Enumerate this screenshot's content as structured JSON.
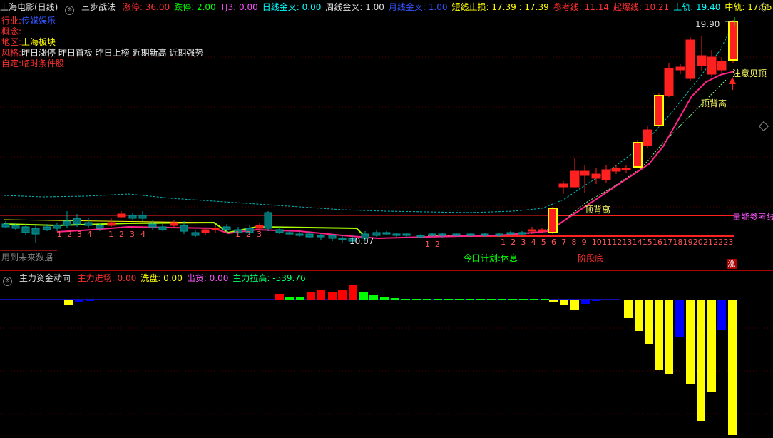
{
  "main_header": {
    "title": "上海电影(日线)",
    "indicator": "三步战法",
    "items": [
      {
        "label": "涨停: 36.00",
        "color": "#ff3030"
      },
      {
        "label": "跌停: 2.00",
        "color": "#00ff00"
      },
      {
        "label": "TJ3: 0.00",
        "color": "#ff55ff"
      },
      {
        "label": "日线金叉: 0.00",
        "color": "#00ffff"
      },
      {
        "label": "周线金叉: 1.00",
        "color": "#dddddd"
      },
      {
        "label": "月线金叉: 1.00",
        "color": "#3355ff"
      },
      {
        "label": "短线止损: 17.39 : 17.39",
        "color": "#ffff00"
      },
      {
        "label": "参考线: 11.14",
        "color": "#ff3030"
      },
      {
        "label": "起爆线: 10.21",
        "color": "#ff3030"
      },
      {
        "label": "上轨: 19.40",
        "color": "#00ffff"
      },
      {
        "label": "中轨: 17.65",
        "color": "#ffff00"
      }
    ]
  },
  "info": {
    "industry_label": "行业:",
    "industry": "传媒娱乐",
    "concept_label": "概念:",
    "concept": "",
    "region_label": "地区:",
    "region": "上海板块",
    "style_label": "风格:",
    "style": "昨日涨停 昨日首板 昨日上榜 近期新高 近期强势",
    "custom_label": "自定:",
    "custom": "临时条件股"
  },
  "annotations": {
    "peak_price": "19.90",
    "low_price": "10.07",
    "warning": "注意见顶",
    "divergence1": "顶背离",
    "divergence2": "顶背离",
    "divergence3": "顶背离",
    "volume_ref": "量能参考线",
    "future_data": "用到未来数据",
    "plan": "今日计划:休息",
    "stage": "阶段底",
    "rise_badge": "涨"
  },
  "counts_left": [
    "1",
    "2",
    "3",
    "4",
    "1",
    "2",
    "3",
    "4",
    "1",
    "2",
    "3"
  ],
  "counts_right": [
    "1",
    "2",
    "3",
    "4",
    "5",
    "6",
    "7",
    "8",
    "9",
    "10",
    "11",
    "12",
    "13",
    "14",
    "15",
    "16",
    "17",
    "18",
    "19",
    "20",
    "21",
    "22",
    "23"
  ],
  "counts_mid": [
    "1",
    "2"
  ],
  "sub_header": {
    "indicator": "主力资金动向",
    "items": [
      {
        "label": "主力进场: 0.00",
        "color": "#ff3030"
      },
      {
        "label": "洗盘: 0.00",
        "color": "#ffff00"
      },
      {
        "label": "出货: 0.00",
        "color": "#ff55ff"
      },
      {
        "label": "主力拉高: -539.76",
        "color": "#00ff66"
      }
    ]
  },
  "chart_data": {
    "type": "candlestick",
    "series": [
      {
        "name": "K线",
        "values": [
          10.3,
          10.4,
          10.2,
          10.1,
          10.3,
          10.6,
          10.5,
          10.4,
          10.2,
          10.3,
          10.5,
          10.6,
          10.4,
          10.3,
          10.2,
          10.1,
          10.2,
          10.4,
          10.6,
          10.3,
          10.2,
          10.1,
          10.2,
          10.4,
          10.9,
          11.5,
          12.0,
          12.6,
          13.2,
          13.8,
          14.5,
          15.5,
          16.8,
          17.6,
          18.2,
          18.9,
          18.1,
          17.8,
          17.4
        ]
      },
      {
        "name": "主力资金",
        "values": [
          0,
          0,
          -5,
          -2,
          0,
          0,
          0,
          0,
          0,
          0,
          0,
          0,
          0,
          0,
          0,
          0,
          0,
          0,
          0,
          0,
          0,
          0,
          0,
          0,
          0,
          0,
          0,
          0,
          2,
          5,
          8,
          12,
          18,
          6,
          -3,
          -8,
          -15,
          -30,
          -60,
          -110,
          -140,
          -160,
          -190
        ]
      }
    ]
  }
}
